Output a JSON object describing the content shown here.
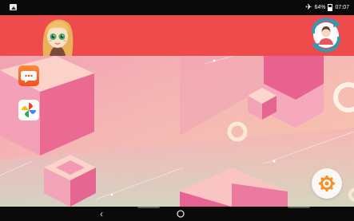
{
  "status_bar": {
    "battery": "64%",
    "time": "07:07",
    "icons": [
      "image-notification-icon",
      "airplane-icon",
      "battery-icon"
    ]
  },
  "header": {
    "color": "#ef4b4d",
    "avatar": "cartoon-girl-avatar",
    "sync_icon": "sync-profile-icon"
  },
  "home": {
    "apps": [
      {
        "name": "messages-app",
        "icon": "chat-bubble-icon"
      },
      {
        "name": "photos-app",
        "icon": "pinwheel-icon"
      }
    ],
    "settings_icon": "gear-icon"
  },
  "nav": {
    "back_glyph": "‹",
    "icons": [
      "back-icon",
      "home-icon"
    ]
  },
  "colors": {
    "accent": "#ef4b4d",
    "wallpaper_pink": "#f4a7b6",
    "wallpaper_peach": "#f6c9a8",
    "settings_orange": "#f2922a"
  }
}
